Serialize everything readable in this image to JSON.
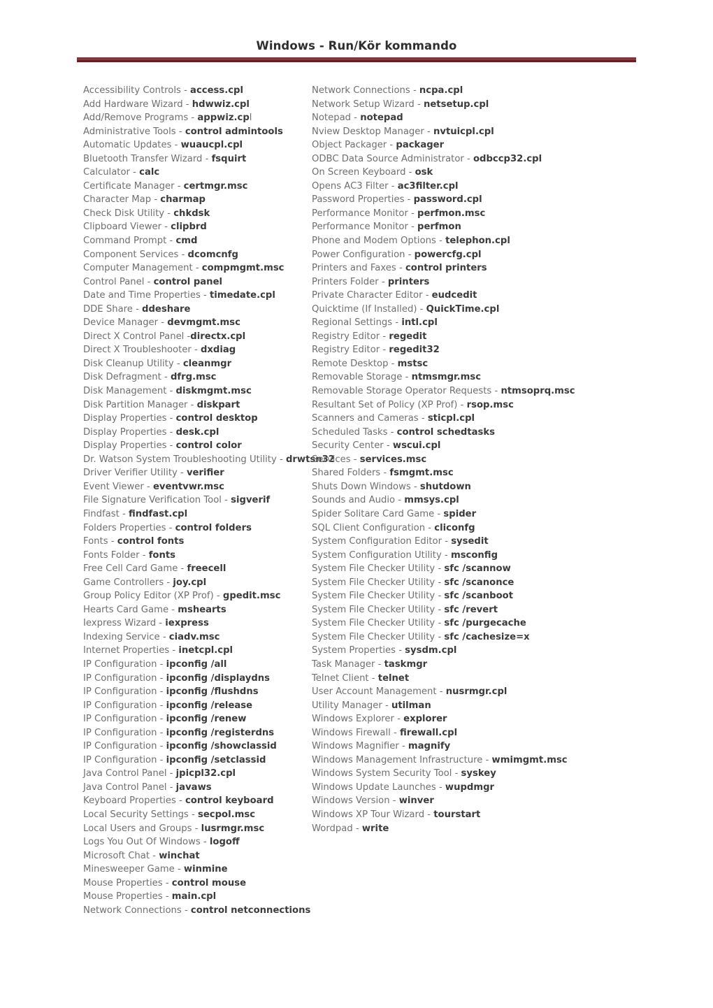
{
  "document": {
    "title": "Windows - Run/Kör kommando",
    "accent_color": "#6e2128",
    "label_color": "#6f6f6f",
    "command_color": "#3c3c3c"
  },
  "columns": {
    "left": [
      {
        "label": "Accessibility Controls",
        "sep": " - ",
        "cmd": "access.cpl"
      },
      {
        "label": "Add Hardware Wizard",
        "sep": " - ",
        "cmd": "hdwwiz.cpl"
      },
      {
        "label": "Add/Remove Programs",
        "sep": " - ",
        "cmd": "appwiz.cp",
        "tail": "l"
      },
      {
        "label": "Administrative Tools",
        "sep": " - ",
        "cmd": "control admintools"
      },
      {
        "label": "Automatic Updates",
        "sep": " - ",
        "cmd": "wuaucpl.cpl"
      },
      {
        "label": "Bluetooth Transfer Wizard",
        "sep": " - ",
        "cmd": "fsquirt"
      },
      {
        "label": "Calculator",
        "sep": " - ",
        "cmd": "calc"
      },
      {
        "label": "Certificate Manager",
        "sep": " - ",
        "cmd": "certmgr.msc"
      },
      {
        "label": "Character Map",
        "sep": " - ",
        "cmd": "charmap"
      },
      {
        "label": "Check Disk Utility",
        "sep": " - ",
        "cmd": "chkdsk"
      },
      {
        "label": "Clipboard Viewer",
        "sep": " - ",
        "cmd": "clipbrd"
      },
      {
        "label": "Command Prompt",
        "sep": " - ",
        "cmd": "cmd"
      },
      {
        "label": "Component Services",
        "sep": " - ",
        "cmd": "dcomcnfg"
      },
      {
        "label": "Computer Management",
        "sep": " - ",
        "cmd": "compmgmt.msc"
      },
      {
        "label": "Control Panel",
        "sep": " - ",
        "cmd": "control panel"
      },
      {
        "label": "Date and Time Properties",
        "sep": " - ",
        "cmd": "timedate.cpl"
      },
      {
        "label": "DDE Share",
        "sep": " - ",
        "cmd": "ddeshare"
      },
      {
        "label": "Device Manager",
        "sep": " - ",
        "cmd": "devmgmt.msc"
      },
      {
        "label": "Direct X Control Panel",
        "sep": " -",
        "cmd": "directx.cpl"
      },
      {
        "label": "Direct X Troubleshooter",
        "sep": " - ",
        "cmd": "dxdiag"
      },
      {
        "label": "Disk Cleanup Utility",
        "sep": " - ",
        "cmd": "cleanmgr"
      },
      {
        "label": "Disk Defragment",
        "sep": " - ",
        "cmd": "dfrg.msc"
      },
      {
        "label": "Disk Management",
        "sep": " - ",
        "cmd": "diskmgmt.msc"
      },
      {
        "label": "Disk Partition Manager",
        "sep": " - ",
        "cmd": "diskpart"
      },
      {
        "label": "Display Properties",
        "sep": " - ",
        "cmd": "control desktop"
      },
      {
        "label": "Display Properties",
        "sep": " - ",
        "cmd": "desk.cpl"
      },
      {
        "label": "Display Properties",
        "sep": " - ",
        "cmd": "control color"
      },
      {
        "label": "Dr. Watson System Troubleshooting Utility",
        "sep": " - ",
        "cmd": "drwtsn32"
      },
      {
        "label": "Driver Verifier Utility",
        "sep": " - ",
        "cmd": "verifier"
      },
      {
        "label": "Event Viewer",
        "sep": " - ",
        "cmd": "eventvwr.msc"
      },
      {
        "label": "File Signature Verification Tool",
        "sep": " - ",
        "cmd": "sigverif"
      },
      {
        "label": "Findfast",
        "sep": " - ",
        "cmd": "findfast.cpl"
      },
      {
        "label": "Folders Properties",
        "sep": " - ",
        "cmd": "control folders"
      },
      {
        "label": "Fonts",
        "sep": " - ",
        "cmd": "control fonts"
      },
      {
        "label": "Fonts Folder",
        "sep": " - ",
        "cmd": "fonts"
      },
      {
        "label": "Free Cell Card Game",
        "sep": " - ",
        "cmd": "freecell"
      },
      {
        "label": "Game Controllers",
        "sep": " - ",
        "cmd": "joy.cpl"
      },
      {
        "label": "Group Policy Editor (XP Prof)",
        "sep": " - ",
        "cmd": "gpedit.msc"
      },
      {
        "label": "Hearts Card Game",
        "sep": " - ",
        "cmd": "mshearts"
      },
      {
        "label": "Iexpress Wizard",
        "sep": " - ",
        "cmd": "iexpress"
      },
      {
        "label": "Indexing Service",
        "sep": " - ",
        "cmd": "ciadv.msc"
      },
      {
        "label": "Internet Properties",
        "sep": " - ",
        "cmd": "inetcpl.cpl"
      },
      {
        "label": "IP Configuration",
        "sep": " - ",
        "cmd": "ipconfig /all"
      },
      {
        "label": "IP Configuration",
        "sep": " - ",
        "cmd": "ipconfig /displaydns"
      },
      {
        "label": "IP Configuration",
        "sep": " - ",
        "cmd": "ipconfig /flushdns"
      },
      {
        "label": "IP Configuration",
        "sep": " - ",
        "cmd": "ipconfig /release"
      },
      {
        "label": "IP Configuration",
        "sep": " - ",
        "cmd": "ipconfig /renew"
      },
      {
        "label": "IP Configuration",
        "sep": " - ",
        "cmd": "ipconfig /registerdns"
      },
      {
        "label": "IP Configuration",
        "sep": " - ",
        "cmd": "ipconfig /showclassid"
      },
      {
        "label": "IP Configuration",
        "sep": " - ",
        "cmd": "ipconfig /setclassid"
      },
      {
        "label": "Java Control Panel",
        "sep": " - ",
        "cmd": "jpicpl32.cpl"
      },
      {
        "label": "Java Control Panel",
        "sep": " - ",
        "cmd": "javaws"
      },
      {
        "label": "Keyboard Properties",
        "sep": " - ",
        "cmd": "control keyboard"
      },
      {
        "label": "Local Security Settings",
        "sep": " - ",
        "cmd": "secpol.msc"
      },
      {
        "label": "Local Users and Groups",
        "sep": " - ",
        "cmd": "lusrmgr.msc"
      },
      {
        "label": "Logs You Out Of Windows",
        "sep": " - ",
        "cmd": "logoff"
      },
      {
        "label": "Microsoft Chat",
        "sep": " - ",
        "cmd": "winchat"
      },
      {
        "label": "Minesweeper Game",
        "sep": " - ",
        "cmd": "winmine"
      },
      {
        "label": "Mouse Properties",
        "sep": " - ",
        "cmd": "control mouse"
      },
      {
        "label": "Mouse Properties",
        "sep": " - ",
        "cmd": "main.cpl"
      },
      {
        "label": "Network Connections",
        "sep": " - ",
        "cmd": "control netconnections"
      }
    ],
    "right": [
      {
        "label": "Network Connections",
        "sep": " - ",
        "cmd": "ncpa.cpl"
      },
      {
        "label": "Network Setup Wizard",
        "sep": " - ",
        "cmd": "netsetup.cpl"
      },
      {
        "label": "Notepad",
        "sep": " - ",
        "cmd": "notepad"
      },
      {
        "label": "Nview Desktop Manager",
        "sep": " - ",
        "cmd": "nvtuicpl.cpl"
      },
      {
        "label": "Object Packager",
        "sep": " - ",
        "cmd": "packager"
      },
      {
        "label": "ODBC Data Source Administrator",
        "sep": " - ",
        "cmd": "odbccp32.cpl"
      },
      {
        "label": "On Screen Keyboard",
        "sep": " - ",
        "cmd": "osk"
      },
      {
        "label": "Opens AC3 Filter",
        "sep": " - ",
        "cmd": "ac3filter.cpl"
      },
      {
        "label": "Password Properties",
        "sep": " - ",
        "cmd": "password.cpl"
      },
      {
        "label": "Performance Monitor",
        "sep": " - ",
        "cmd": "perfmon.msc"
      },
      {
        "label": "Performance Monitor",
        "sep": " - ",
        "cmd": "perfmon"
      },
      {
        "label": "Phone and Modem Options",
        "sep": " - ",
        "cmd": "telephon.cpl"
      },
      {
        "label": "Power Configuration",
        "sep": " - ",
        "cmd": "powercfg.cpl"
      },
      {
        "label": "Printers and Faxes",
        "sep": " - ",
        "cmd": "control printers"
      },
      {
        "label": "Printers Folder",
        "sep": " - ",
        "cmd": "printers"
      },
      {
        "label": "Private Character Editor",
        "sep": " - ",
        "cmd": "eudcedit"
      },
      {
        "label": "Quicktime (If Installed)",
        "sep": " - ",
        "cmd": "QuickTime.cpl"
      },
      {
        "label": "Regional Settings",
        "sep": " - ",
        "cmd": "intl.cpl"
      },
      {
        "label": "Registry Editor",
        "sep": " - ",
        "cmd": "regedit"
      },
      {
        "label": "Registry Editor",
        "sep": " - ",
        "cmd": "regedit32"
      },
      {
        "label": "Remote Desktop",
        "sep": " - ",
        "cmd": "mstsc"
      },
      {
        "label": "Removable Storage",
        "sep": " - ",
        "cmd": "ntmsmgr.msc"
      },
      {
        "label": "Removable Storage Operator Requests",
        "sep": " - ",
        "cmd": "ntmsoprq.msc"
      },
      {
        "label": "Resultant Set of Policy (XP Prof)",
        "sep": " - ",
        "cmd": "rsop.msc"
      },
      {
        "label": "Scanners and Cameras",
        "sep": " - ",
        "cmd": "sticpl.cpl"
      },
      {
        "label": "Scheduled Tasks",
        "sep": " - ",
        "cmd": "control schedtasks"
      },
      {
        "label": "Security Center",
        "sep": " - ",
        "cmd": "wscui.cpl"
      },
      {
        "label": "Services",
        "sep": " - ",
        "cmd": "services.msc"
      },
      {
        "label": "Shared Folders",
        "sep": " - ",
        "cmd": "fsmgmt.msc"
      },
      {
        "label": "Shuts Down Windows",
        "sep": " - ",
        "cmd": "shutdown"
      },
      {
        "label": "Sounds and Audio",
        "sep": " - ",
        "cmd": "mmsys.cpl"
      },
      {
        "label": "Spider Solitare Card Game",
        "sep": " - ",
        "cmd": "spider"
      },
      {
        "label": "SQL Client Configuration",
        "sep": " - ",
        "cmd": "cliconfg"
      },
      {
        "label": "System Configuration Editor",
        "sep": " - ",
        "cmd": "sysedit"
      },
      {
        "label": "System Configuration Utility",
        "sep": " - ",
        "cmd": "msconfig"
      },
      {
        "label": "System File Checker Utility",
        "sep": " - ",
        "cmd": "sfc /scannow"
      },
      {
        "label": "System File Checker Utility",
        "sep": " - ",
        "cmd": "sfc /scanonce"
      },
      {
        "label": "System File Checker Utility",
        "sep": " - ",
        "cmd": "sfc /scanboot"
      },
      {
        "label": "System File Checker Utility",
        "sep": " - ",
        "cmd": "sfc /revert"
      },
      {
        "label": "System File Checker Utility",
        "sep": " - ",
        "cmd": "sfc /purgecache"
      },
      {
        "label": "System File Checker Utility",
        "sep": " - ",
        "cmd": "sfc /cachesize=x"
      },
      {
        "label": "System Properties",
        "sep": " - ",
        "cmd": "sysdm.cpl"
      },
      {
        "label": "Task Manager",
        "sep": " - ",
        "cmd": "taskmgr"
      },
      {
        "label": "Telnet Client",
        "sep": " - ",
        "cmd": "telnet"
      },
      {
        "label": "User Account Management",
        "sep": " - ",
        "cmd": "nusrmgr.cpl"
      },
      {
        "label": "Utility Manager",
        "sep": " - ",
        "cmd": "utilman"
      },
      {
        "label": "Windows Explorer",
        "sep": " - ",
        "cmd": "explorer"
      },
      {
        "label": "Windows Firewall",
        "sep": " - ",
        "cmd": "firewall.cpl"
      },
      {
        "label": "Windows Magnifier",
        "sep": " - ",
        "cmd": "magnify"
      },
      {
        "label": "Windows Management Infrastructure",
        "sep": " - ",
        "cmd": "wmimgmt.msc"
      },
      {
        "label": "Windows System Security Tool",
        "sep": " - ",
        "cmd": "syskey"
      },
      {
        "label": "Windows Update Launches",
        "sep": " - ",
        "cmd": "wupdmgr"
      },
      {
        "label": "Windows Version",
        "sep": " - ",
        "cmd": "winver"
      },
      {
        "label": "Windows XP Tour Wizard",
        "sep": " - ",
        "cmd": "tourstart"
      },
      {
        "label": "Wordpad",
        "sep": " - ",
        "cmd": "write"
      }
    ]
  }
}
